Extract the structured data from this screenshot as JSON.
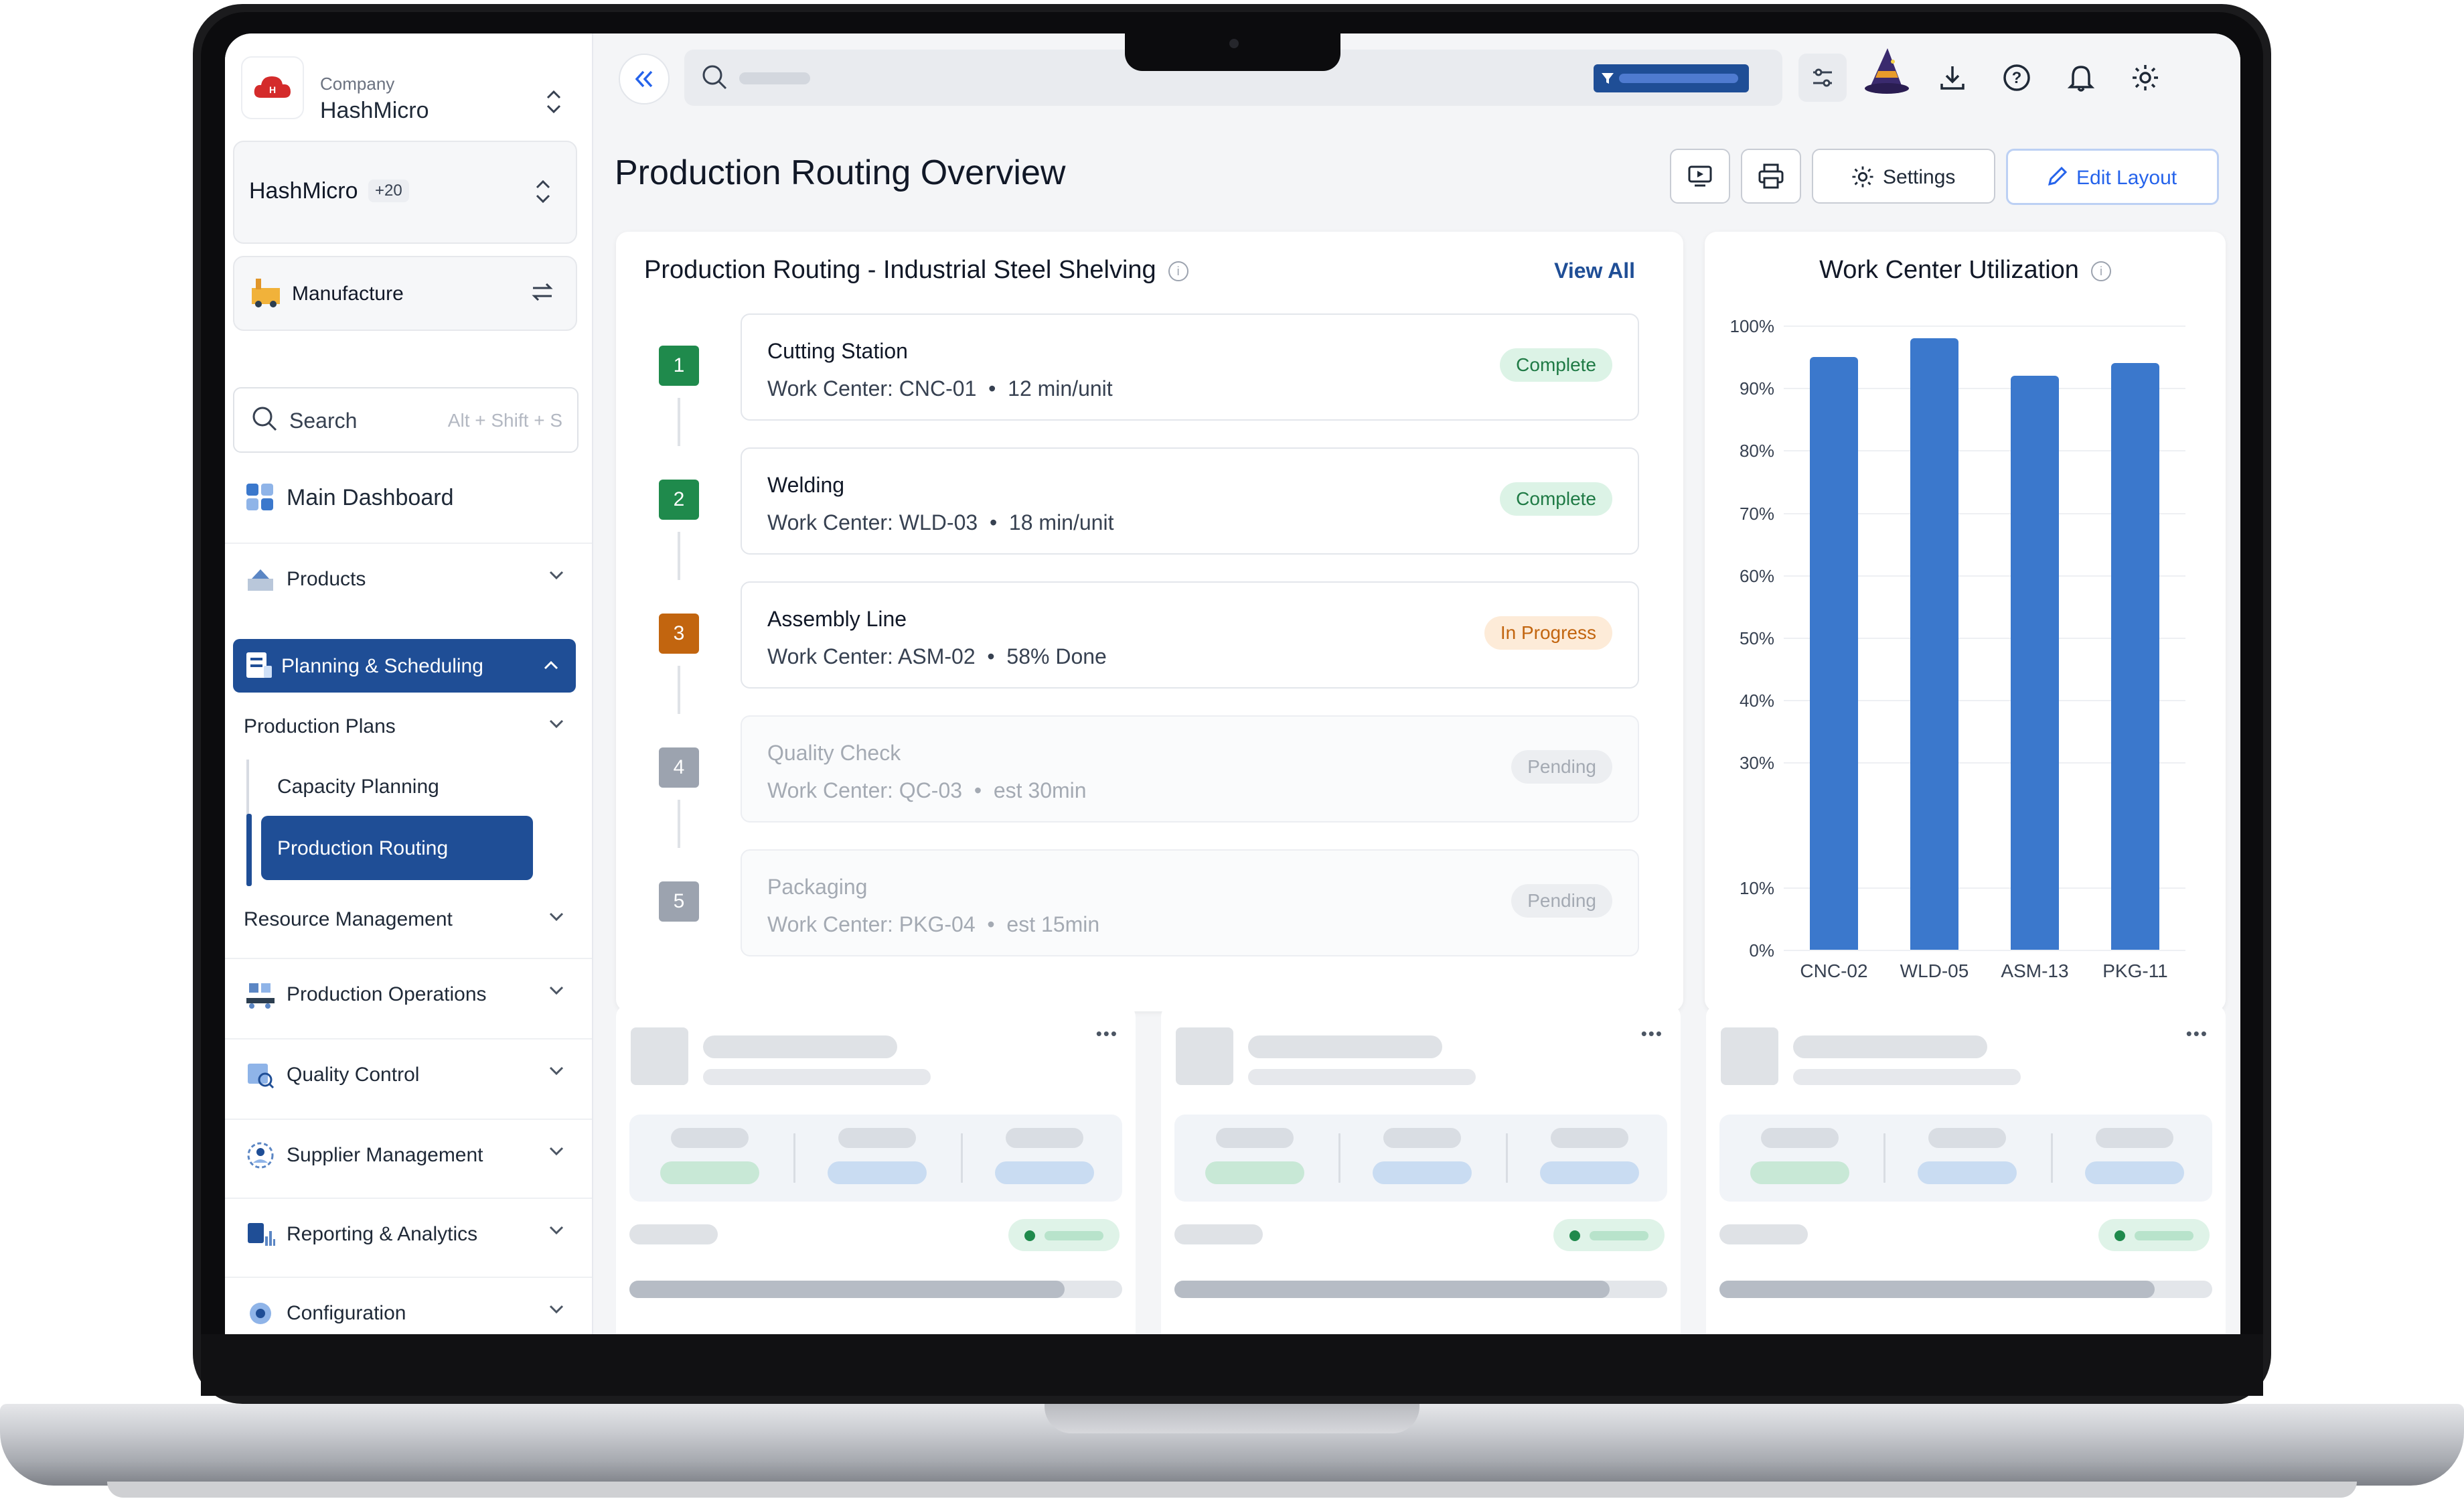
{
  "sidebar": {
    "company_label": "Company",
    "company_name": "HashMicro",
    "workspace": {
      "name": "HashMicro",
      "badge": "+20"
    },
    "module": {
      "label": "Manufacture"
    },
    "search": {
      "label": "Search",
      "shortcut": "Alt + Shift + S"
    },
    "main_dashboard": "Main Dashboard",
    "products": "Products",
    "planning": "Planning & Scheduling",
    "production_plans": "Production Plans",
    "capacity_planning": "Capacity Planning",
    "production_routing": "Production Routing",
    "resource_management": "Resource Management",
    "production_operations": "Production Operations",
    "quality_control": "Quality Control",
    "supplier_management": "Supplier Management",
    "reporting_analytics": "Reporting & Analytics",
    "configuration": "Configuration"
  },
  "header": {
    "title": "Production Routing Overview",
    "settings_label": "Settings",
    "edit_layout_label": "Edit Layout"
  },
  "routing": {
    "title": "Production Routing - Industrial Steel Shelving",
    "view_all": "View All",
    "steps": [
      {
        "num": "1",
        "name": "Cutting Station",
        "center": "Work Center: CNC-01",
        "detail": "12 min/unit",
        "status": "Complete"
      },
      {
        "num": "2",
        "name": "Welding",
        "center": "Work Center: WLD-03",
        "detail": "18 min/unit",
        "status": "Complete"
      },
      {
        "num": "3",
        "name": "Assembly Line",
        "center": "Work Center: ASM-02",
        "detail": "58% Done",
        "status": "In Progress"
      },
      {
        "num": "4",
        "name": "Quality Check",
        "center": "Work Center: QC-03",
        "detail": "est 30min",
        "status": "Pending"
      },
      {
        "num": "5",
        "name": "Packaging",
        "center": "Work Center: PKG-04",
        "detail": "est 15min",
        "status": "Pending"
      }
    ],
    "colors": {
      "complete": "#1f8a4c",
      "in_progress": "#c2650f",
      "pending": "#9ca3af"
    }
  },
  "chart_data": {
    "type": "bar",
    "title": "Work Center Utilization",
    "categories": [
      "CNC-02",
      "WLD-05",
      "ASM-13",
      "PKG-11"
    ],
    "values": [
      95,
      98,
      92,
      94
    ],
    "ylim": [
      0,
      100
    ],
    "yticks": [
      "100%",
      "90%",
      "80%",
      "70%",
      "60%",
      "50%",
      "40%",
      "30%",
      "10%",
      "0%"
    ],
    "bar_color": "#3b78cc"
  }
}
